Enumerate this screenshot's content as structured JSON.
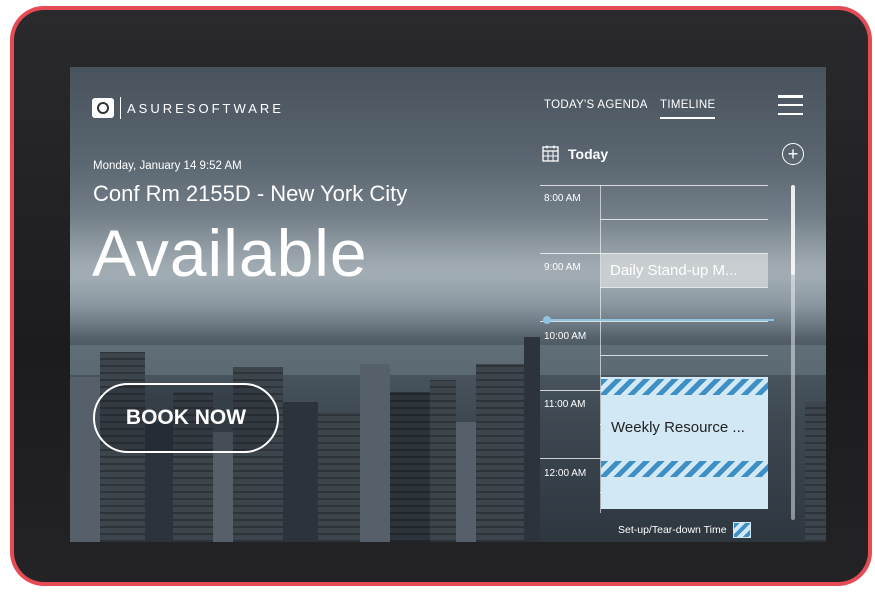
{
  "brand": {
    "name": "ASURESOFTWARE",
    "logo_icon": "asure-logo-icon"
  },
  "header": {
    "datetime": "Monday, January 14 9:52 AM"
  },
  "room": {
    "name": "Conf Rm 2155D - New York City",
    "status": "Available"
  },
  "actions": {
    "book_label": "BOOK NOW"
  },
  "nav": {
    "tabs": [
      {
        "label": "TODAY'S AGENDA",
        "active": false
      },
      {
        "label": "TIMELINE",
        "active": true
      }
    ],
    "menu_icon": "hamburger-menu-icon"
  },
  "timeline": {
    "day_label": "Today",
    "calendar_icon": "calendar-icon",
    "add_icon": "plus-circle-icon",
    "hours": [
      "8:00 AM",
      "9:00 AM",
      "10:00 AM",
      "11:00 AM",
      "12:00 AM"
    ],
    "events": [
      {
        "title": "Daily Stand-up M...",
        "style": "past"
      },
      {
        "title": "Weekly Resource ...",
        "style": "upcoming-with-setup"
      }
    ],
    "legend": {
      "label": "Set-up/Tear-down Time"
    }
  },
  "colors": {
    "device_frame": "#e64a55",
    "event_fill": "#d3e8f5",
    "setup_stripe": "#3d8fc4",
    "now_indicator": "#8fc3e0"
  }
}
